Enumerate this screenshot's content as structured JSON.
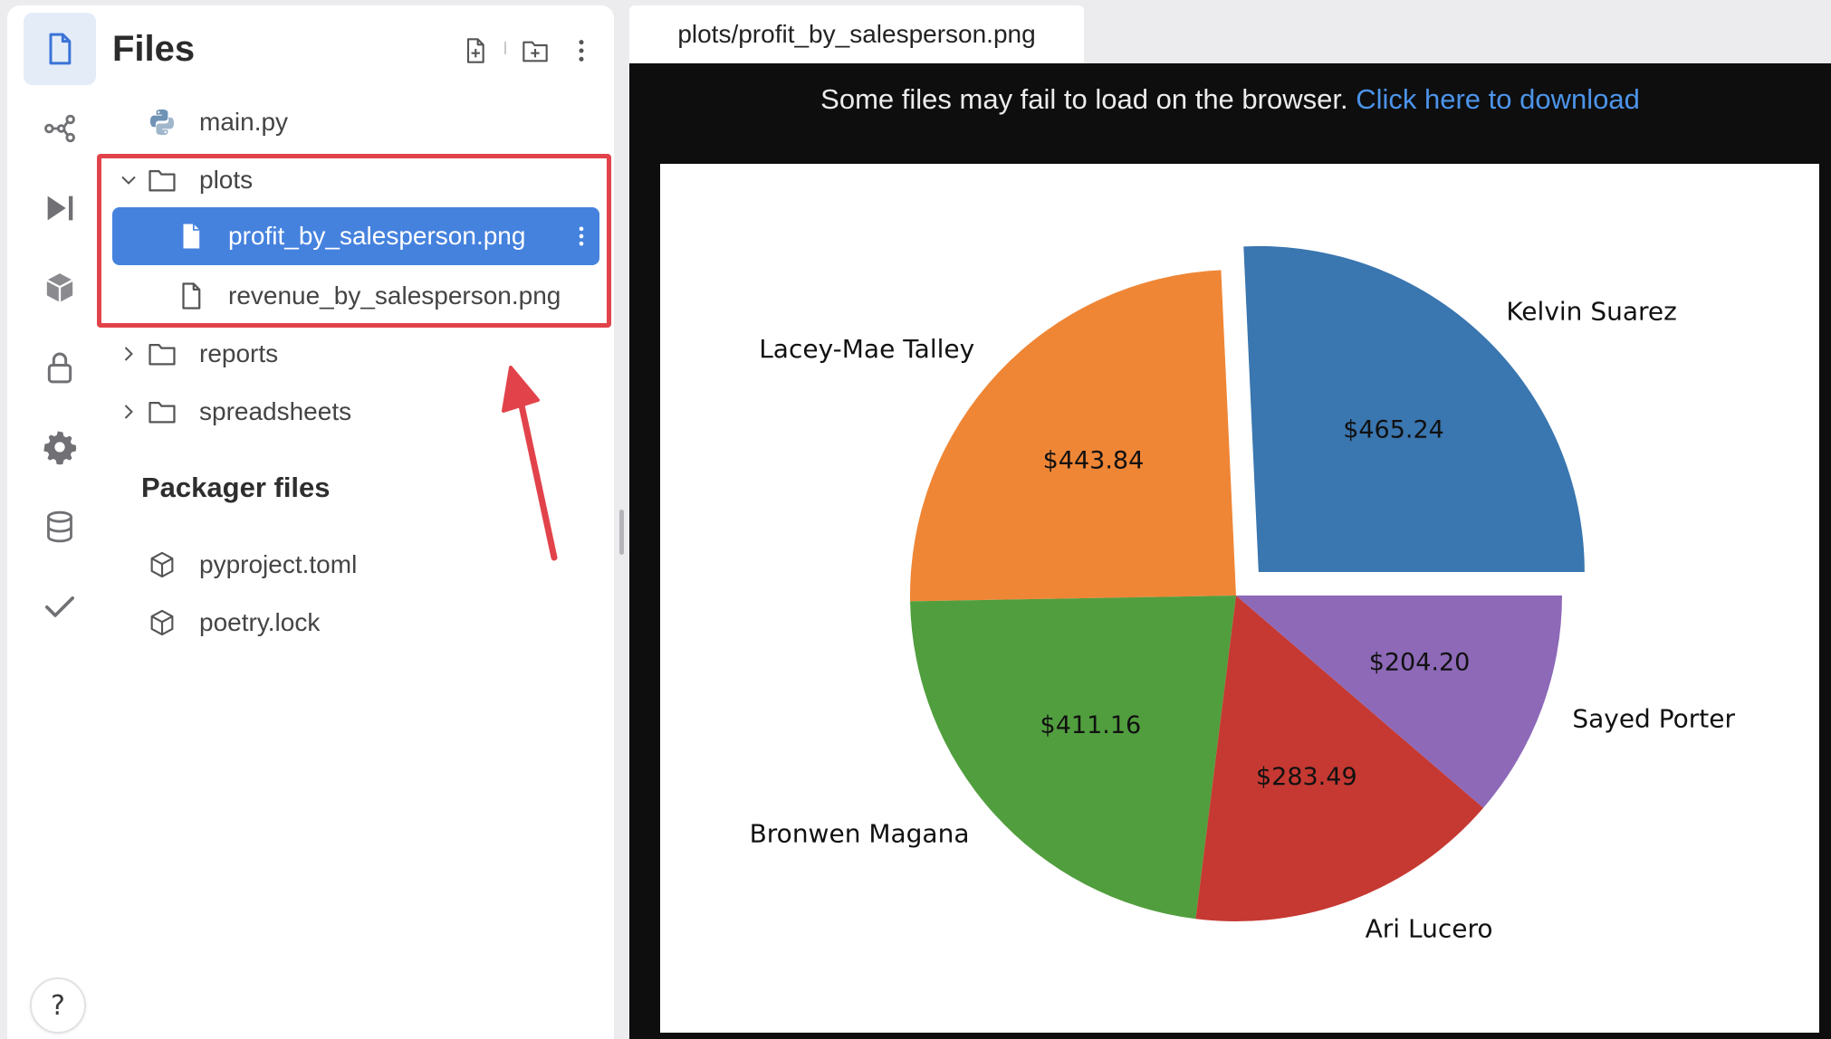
{
  "sidebar": {
    "icons": [
      "file-icon",
      "share-graph-icon",
      "run-step-icon",
      "package-icon",
      "lock-icon",
      "gear-icon",
      "database-icon",
      "checkmark-icon"
    ],
    "help_label": "?"
  },
  "files_panel": {
    "title": "Files",
    "header_buttons": [
      "new-file-icon",
      "new-folder-icon",
      "more-vert-icon"
    ],
    "tree": {
      "main_py": "main.py",
      "plots": "plots",
      "profit_png": "profit_by_salesperson.png",
      "revenue_png": "revenue_by_salesperson.png",
      "reports": "reports",
      "spreadsheets": "spreadsheets"
    },
    "packager": {
      "title": "Packager files",
      "items": [
        "pyproject.toml",
        "poetry.lock"
      ]
    }
  },
  "preview": {
    "tab_label": "plots/profit_by_salesperson.png",
    "notice_text": "Some files may fail to load on the browser.",
    "download_link": "Click here to download"
  },
  "annotation": {
    "highlight_color": "#e2434b"
  },
  "chart_data": {
    "type": "pie",
    "title": "",
    "categories": [
      "Kelvin Suarez",
      "Lacey-Mae Talley",
      "Bronwen Magana",
      "Ari Lucero",
      "Sayed Porter"
    ],
    "values": [
      465.24,
      443.84,
      411.16,
      283.49,
      204.2
    ],
    "value_labels": [
      "$465.24",
      "$443.84",
      "$411.16",
      "$283.49",
      "$204.20"
    ],
    "colors": [
      "#3a76af",
      "#ef8636",
      "#519e3e",
      "#c53932",
      "#8d69b8"
    ],
    "explode": [
      0.1,
      0,
      0,
      0,
      0
    ],
    "start_angle_deg": 0,
    "direction": "counterclockwise"
  }
}
